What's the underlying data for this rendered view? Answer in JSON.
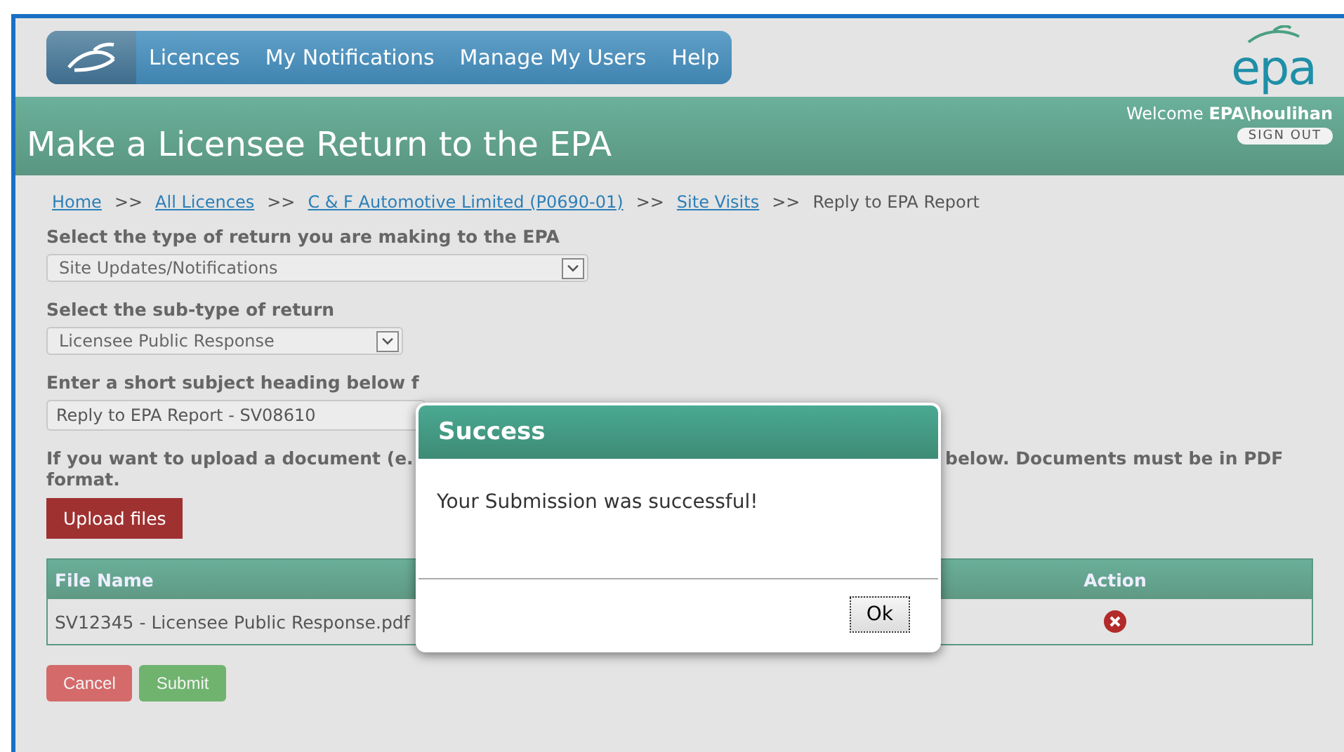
{
  "nav": {
    "items": [
      "Licences",
      "My Notifications",
      "Manage My Users",
      "Help"
    ]
  },
  "logo": {
    "text": "epa"
  },
  "header": {
    "title": "Make a Licensee Return to the EPA",
    "welcome": "Welcome",
    "user": "EPA\\houlihan",
    "sign_out": "SIGN OUT"
  },
  "breadcrumb": [
    {
      "label": "Home",
      "link": true
    },
    {
      "label": "All Licences",
      "link": true
    },
    {
      "label": "C & F Automotive Limited (P0690-01)",
      "link": true
    },
    {
      "label": "Site Visits",
      "link": true
    },
    {
      "label": "Reply to EPA Report",
      "link": false
    }
  ],
  "separator": ">>",
  "return_type": {
    "label": "Select the type of return you are making to the EPA",
    "value": "Site Updates/Notifications"
  },
  "sub_type": {
    "label": "Select the sub-type of return",
    "value": "Licensee Public Response"
  },
  "subject": {
    "label_visible": "Enter a short subject heading below f",
    "value": "Reply to EPA Report - SV08610"
  },
  "upload": {
    "text_left": "If you want to upload a document (e.",
    "text_right": "below. Documents must be in PDF",
    "text_line2": "format.",
    "button": "Upload files"
  },
  "table": {
    "columns": [
      "File Name",
      "Action"
    ],
    "rows": [
      {
        "file": "SV12345 - Licensee Public Response.pdf"
      }
    ]
  },
  "buttons": {
    "cancel": "Cancel",
    "submit": "Submit"
  },
  "dialog": {
    "title": "Success",
    "message": "Your Submission was successful!",
    "ok": "Ok"
  }
}
